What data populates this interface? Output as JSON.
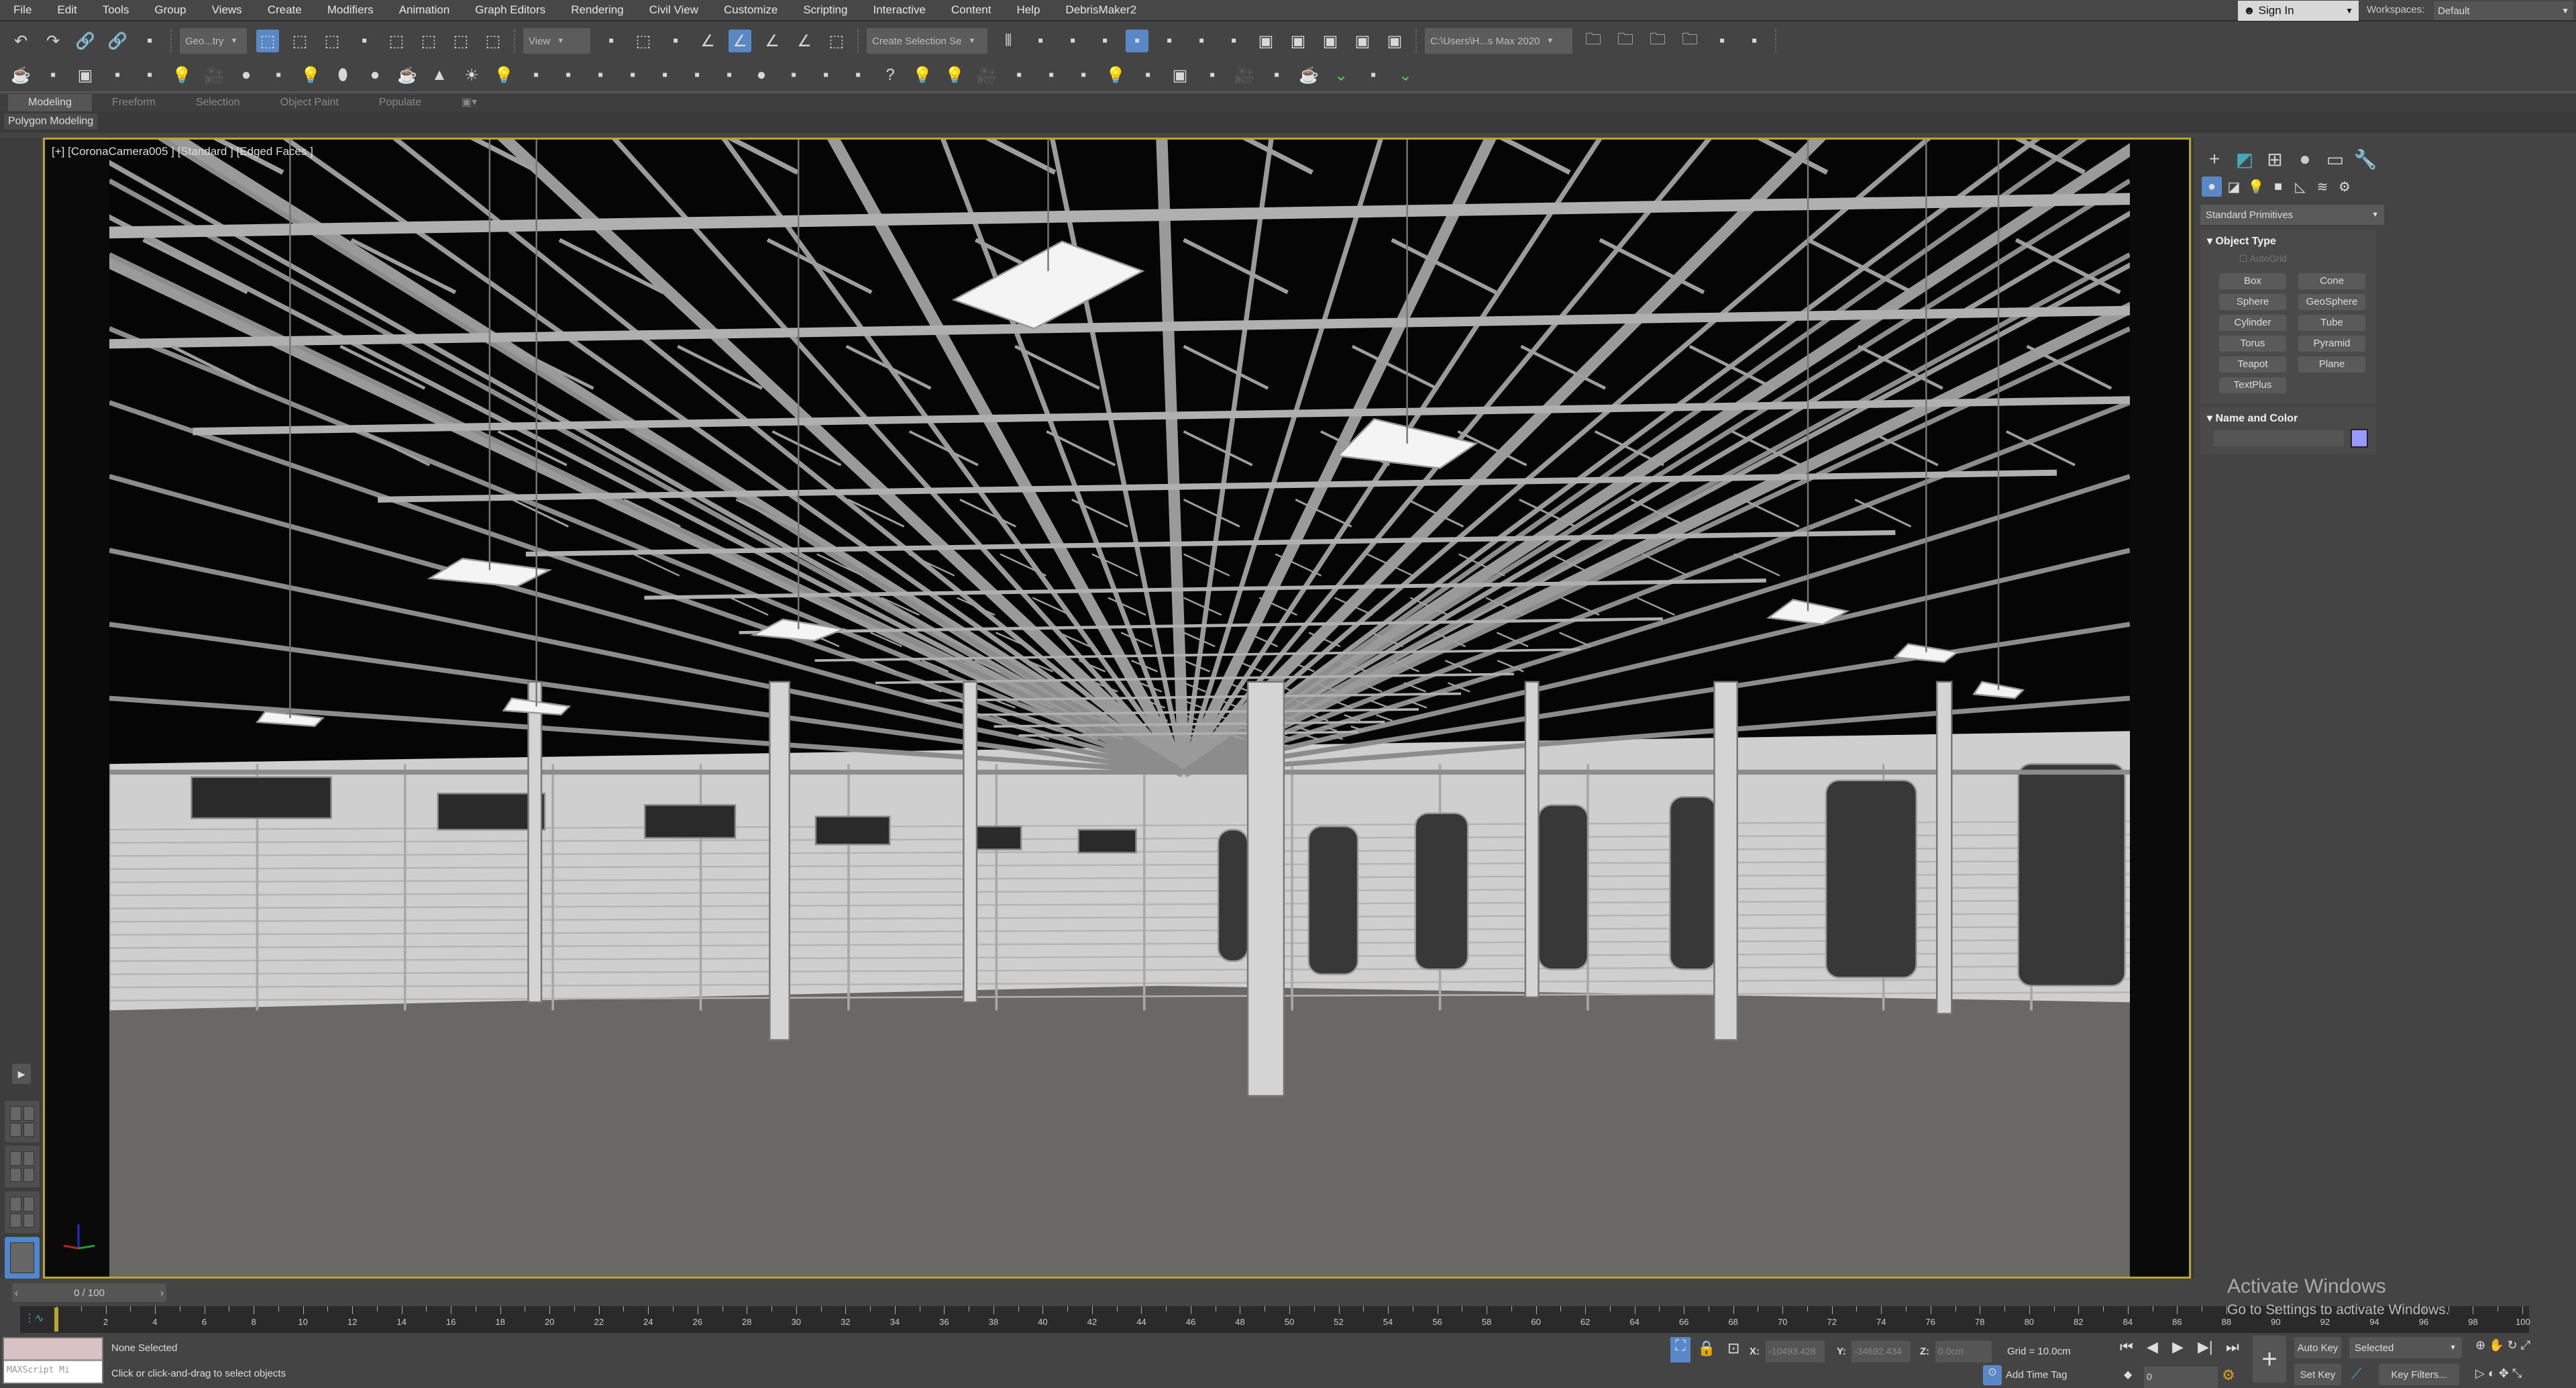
{
  "menu": [
    "File",
    "Edit",
    "Tools",
    "Group",
    "Views",
    "Create",
    "Modifiers",
    "Animation",
    "Graph Editors",
    "Rendering",
    "Civil View",
    "Customize",
    "Scripting",
    "Interactive",
    "Content",
    "Help",
    "DebrisMaker2"
  ],
  "account": {
    "sign_in": "Sign In",
    "workspaces_label": "Workspaces:",
    "workspace": "Default"
  },
  "toolbar1": {
    "icons_a": [
      "undo-icon",
      "redo-icon",
      "link-icon",
      "unlink-icon",
      "bind-space-warp-icon"
    ],
    "selection_filter": "Geo...try",
    "icons_b": [
      "select-object-icon",
      "select-by-name-icon",
      "rectangular-selection-icon",
      "window-crossing-icon",
      "select-move-icon",
      "select-rotate-icon",
      "select-scale-icon",
      "select-place-icon"
    ],
    "ref_coord": "View",
    "icons_c": [
      "pivot-center-icon",
      "select-manipulate-icon",
      "keyboard-shortcut-icon",
      "snaps-toggle-icon",
      "angle-snap-icon",
      "percent-snap-icon",
      "spinner-snap-icon",
      "edit-named-selection-icon"
    ],
    "named_selection": "Create Selection Se",
    "icons_d": [
      "mirror-icon",
      "align-icon",
      "scene-explorer-icon",
      "layer-explorer-icon",
      "toggle-ribbon-icon",
      "curve-editor-icon",
      "schematic-view-icon",
      "material-editor-icon",
      "render-setup-icon",
      "rendered-frame-window-icon",
      "render-icon",
      "render-iterative-icon",
      "render-online-icon"
    ],
    "project_path": "C:\\Users\\H...s Max 2020",
    "icons_e": [
      "project-folder-icon",
      "open-folder-icon",
      "folder-tree-icon",
      "folder-settings-icon",
      "paint-tool-icon",
      "transform-gizmo-icon"
    ]
  },
  "toolbar2": {
    "icons": [
      "teapot-icon",
      "cloud-icon",
      "render-frame-icon",
      "panel-icon",
      "panel-icon-2",
      "light-bulb-icon",
      "camera-icon",
      "sphere-half-icon",
      "film-icon",
      "box-light-icon",
      "egg-icon",
      "glow-sphere-icon",
      "teapot-mesh-icon",
      "cone-icon",
      "sun-icon",
      "ellipse-light-icon",
      "checker-icon",
      "atom-icon",
      "tree-icon",
      "snowflake-icon",
      "grass-icon",
      "hair-icon",
      "disp-icon",
      "sphere-icon",
      "converter-icon",
      "proxy-icon",
      "layer-icon",
      "help-icon",
      "light-icon",
      "star-light-icon",
      "camera-add-icon",
      "pine-icon",
      "frame-icon",
      "pine-tree-icon",
      "lightbulb-outline-icon",
      "ring-icon",
      "render-region-icon",
      "pan-icon",
      "camera-plus-icon",
      "frame-2-icon",
      "teapot-outline-icon",
      "chevron-double-down-icon",
      "probe-icon",
      "chevron-double-down-icon-2"
    ]
  },
  "ribbon": {
    "tabs": [
      "Modeling",
      "Freeform",
      "Selection",
      "Object Paint",
      "Populate"
    ],
    "panel": "Polygon Modeling"
  },
  "viewport": {
    "label": "[+] [CoronaCamera005 ] [Standard ] [Edged Faces ]"
  },
  "command_panel": {
    "category": "Standard Primitives",
    "object_type": {
      "title": "Object Type",
      "autogrid": "AutoGrid",
      "buttons": [
        "Box",
        "Cone",
        "Sphere",
        "GeoSphere",
        "Cylinder",
        "Tube",
        "Torus",
        "Pyramid",
        "Teapot",
        "Plane",
        "TextPlus"
      ]
    },
    "name_color": {
      "title": "Name and Color",
      "name_value": "",
      "color": "#9999ff"
    }
  },
  "timeline": {
    "slider": "0 / 100",
    "start": 0,
    "end": 100,
    "label_step": 2,
    "current": 0
  },
  "watermark": {
    "line1": "Activate Windows",
    "line2": "Go to Settings to activate Windows."
  },
  "status": {
    "maxscript": "MAXScript Mi",
    "selection": "None Selected",
    "prompt": "Click or click-and-drag to select objects",
    "x_label": "X:",
    "x": "-10493.428",
    "y_label": "Y:",
    "y": "-34692.434",
    "z_label": "Z:",
    "z": "0.0cm",
    "grid": "Grid = 10.0cm",
    "add_time_tag": "Add Time Tag",
    "auto_key": "Auto Key",
    "set_key": "Set Key",
    "key_mode": "Selected",
    "key_filters": "Key Filters...",
    "frame": "0"
  }
}
